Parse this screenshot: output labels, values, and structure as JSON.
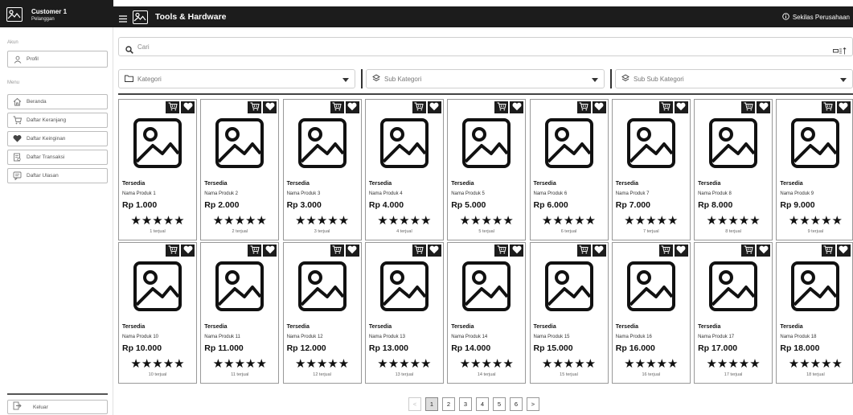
{
  "user": {
    "name": "Customer 1",
    "role": "Pelanggan"
  },
  "header": {
    "title": "Tools & Hardware",
    "about_label": "Sekilas Perusahaan"
  },
  "sidebar": {
    "account_section": "Akun",
    "profile_label": "Profil",
    "menu_section": "Menu",
    "items": [
      {
        "label": "Beranda",
        "icon": "home-icon"
      },
      {
        "label": "Daftar Keranjang",
        "icon": "cart-icon"
      },
      {
        "label": "Daftar Keinginan",
        "icon": "heart-icon"
      },
      {
        "label": "Daftar Transaksi",
        "icon": "receipt-icon"
      },
      {
        "label": "Daftar Ulasan",
        "icon": "review-icon"
      }
    ],
    "logout_label": "Keluar"
  },
  "search": {
    "placeholder": "Cari",
    "value": ""
  },
  "filters": {
    "category": "Kategori",
    "sub_category": "Sub Kategori",
    "sub_sub_category": "Sub Sub Kategori"
  },
  "products": [
    {
      "status": "Tersedia",
      "name": "Nama Produk 1",
      "price": "Rp 1.000",
      "rating": "★★★★★",
      "sold": "1 terjual"
    },
    {
      "status": "Tersedia",
      "name": "Nama Produk 2",
      "price": "Rp 2.000",
      "rating": "★★★★★",
      "sold": "2 terjual"
    },
    {
      "status": "Tersedia",
      "name": "Nama Produk 3",
      "price": "Rp 3.000",
      "rating": "★★★★★",
      "sold": "3 terjual"
    },
    {
      "status": "Tersedia",
      "name": "Nama Produk 4",
      "price": "Rp 4.000",
      "rating": "★★★★★",
      "sold": "4 terjual"
    },
    {
      "status": "Tersedia",
      "name": "Nama Produk 5",
      "price": "Rp 5.000",
      "rating": "★★★★★",
      "sold": "5 terjual"
    },
    {
      "status": "Tersedia",
      "name": "Nama Produk 6",
      "price": "Rp 6.000",
      "rating": "★★★★★",
      "sold": "6 terjual"
    },
    {
      "status": "Tersedia",
      "name": "Nama Produk 7",
      "price": "Rp 7.000",
      "rating": "★★★★★",
      "sold": "7 terjual"
    },
    {
      "status": "Tersedia",
      "name": "Nama Produk 8",
      "price": "Rp 8.000",
      "rating": "★★★★★",
      "sold": "8 terjual"
    },
    {
      "status": "Tersedia",
      "name": "Nama Produk 9",
      "price": "Rp 9.000",
      "rating": "★★★★★",
      "sold": "9 terjual"
    },
    {
      "status": "Tersedia",
      "name": "Nama Produk 10",
      "price": "Rp 10.000",
      "rating": "★★★★★",
      "sold": "10 terjual"
    },
    {
      "status": "Tersedia",
      "name": "Nama Produk 11",
      "price": "Rp 11.000",
      "rating": "★★★★★",
      "sold": "11 terjual"
    },
    {
      "status": "Tersedia",
      "name": "Nama Produk 12",
      "price": "Rp 12.000",
      "rating": "★★★★★",
      "sold": "12 terjual"
    },
    {
      "status": "Tersedia",
      "name": "Nama Produk 13",
      "price": "Rp 13.000",
      "rating": "★★★★★",
      "sold": "13 terjual"
    },
    {
      "status": "Tersedia",
      "name": "Nama Produk 14",
      "price": "Rp 14.000",
      "rating": "★★★★★",
      "sold": "14 terjual"
    },
    {
      "status": "Tersedia",
      "name": "Nama Produk 15",
      "price": "Rp 15.000",
      "rating": "★★★★★",
      "sold": "15 terjual"
    },
    {
      "status": "Tersedia",
      "name": "Nama Produk 16",
      "price": "Rp 16.000",
      "rating": "★★★★★",
      "sold": "16 terjual"
    },
    {
      "status": "Tersedia",
      "name": "Nama Produk 17",
      "price": "Rp 17.000",
      "rating": "★★★★★",
      "sold": "17 terjual"
    },
    {
      "status": "Tersedia",
      "name": "Nama Produk 18",
      "price": "Rp 18.000",
      "rating": "★★★★★",
      "sold": "18 terjual"
    }
  ],
  "pagination": {
    "prev": "<",
    "pages": [
      "1",
      "2",
      "3",
      "4",
      "5",
      "6"
    ],
    "current": "1",
    "next": ">"
  },
  "colors": {
    "header_bg": "#1c1c1c",
    "border": "#cfcfcf",
    "active_page": "#dddddd"
  }
}
